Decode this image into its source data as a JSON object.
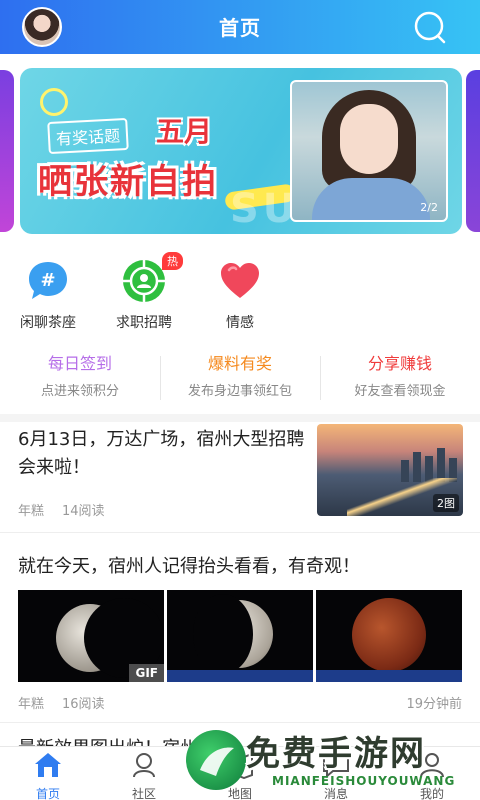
{
  "header": {
    "title": "首页"
  },
  "banner": {
    "tag": "有奖话题",
    "month": "五月",
    "headline": "晒张新自拍",
    "deco_text": "SUM",
    "counter": "2/2"
  },
  "quick": [
    {
      "label": "闲聊茶座",
      "icon": "hash-chat-icon",
      "color": "#3a9ff0"
    },
    {
      "label": "求职招聘",
      "icon": "job-target-icon",
      "color": "#2fbf3f",
      "badge": "热"
    },
    {
      "label": "情感",
      "icon": "heart-icon",
      "color": "#f0475b"
    }
  ],
  "tasks": [
    {
      "title": "每日签到",
      "sub": "点进来领积分",
      "color": "#b66ee8"
    },
    {
      "title": "爆料有奖",
      "sub": "发布身边事领红包",
      "color": "#f58a1f"
    },
    {
      "title": "分享赚钱",
      "sub": "好友查看领现金",
      "color": "#f03c3c"
    }
  ],
  "articles": [
    {
      "title": "6月13日，万达广场，宿州大型招聘会来啦！",
      "author": "年糕",
      "reads": "14阅读",
      "img_count": "2图"
    },
    {
      "title": "就在今天，宿州人记得抬头看看，有奇观！",
      "author": "年糕",
      "reads": "16阅读",
      "time": "19分钟前",
      "gif": "GIF"
    },
    {
      "title": "最新效果图出炉！宿州..."
    }
  ],
  "bottom_nav": [
    {
      "label": "首页",
      "icon": "home-icon",
      "active": true
    },
    {
      "label": "社区",
      "icon": "community-icon"
    },
    {
      "label": "地图",
      "icon": "map-icon"
    },
    {
      "label": "消息",
      "icon": "message-icon"
    },
    {
      "label": "我的",
      "icon": "profile-icon"
    }
  ],
  "watermark": {
    "title": "免费手游网",
    "sub": "MIANFEISHOUYOUWANG"
  }
}
